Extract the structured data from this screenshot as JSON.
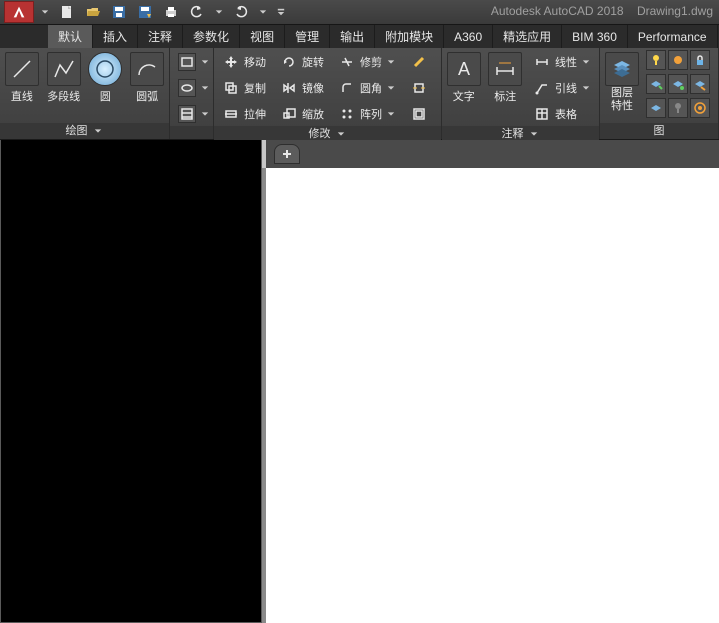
{
  "app": {
    "product": "Autodesk AutoCAD 2018",
    "file": "Drawing1.dwg"
  },
  "tabs": {
    "items": [
      {
        "label": "默认",
        "active": true
      },
      {
        "label": "插入"
      },
      {
        "label": "注释"
      },
      {
        "label": "参数化"
      },
      {
        "label": "视图"
      },
      {
        "label": "管理"
      },
      {
        "label": "输出"
      },
      {
        "label": "附加模块"
      },
      {
        "label": "A360"
      },
      {
        "label": "精选应用"
      },
      {
        "label": "BIM 360"
      },
      {
        "label": "Performance"
      }
    ]
  },
  "ribbon": {
    "draw": {
      "title": "绘图",
      "line": "直线",
      "pline": "多段线",
      "circle": "圆",
      "arc": "圆弧"
    },
    "modify": {
      "title": "修改",
      "move": "移动",
      "copy": "复制",
      "stretch": "拉伸",
      "rotate": "旋转",
      "mirror": "镜像",
      "scale": "缩放",
      "trim": "修剪",
      "fillet": "圆角",
      "array": "阵列"
    },
    "annot": {
      "title": "注释",
      "text": "文字",
      "dim": "标注",
      "linear": "线性",
      "leader": "引线",
      "table": "表格"
    },
    "layer": {
      "title": "图层\n特性",
      "title1": "图层",
      "title2": "特性"
    },
    "panel_right": "图"
  }
}
